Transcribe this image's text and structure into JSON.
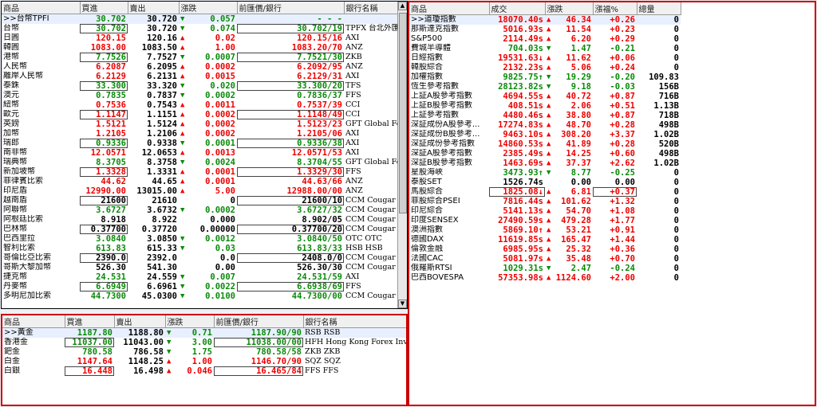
{
  "fx": {
    "headers": [
      "商品",
      "買進",
      "賣出",
      "漲跌",
      "前匯價/銀行",
      "銀行名稱"
    ],
    "rows": [
      {
        "name": ">>台幣TPFI",
        "bid": "30.702",
        "ask": "30.720",
        "chg": "0.057",
        "chg_dir": "down",
        "prev": "- - -",
        "prev_suffix": "",
        "bank": "",
        "color": "g"
      },
      {
        "name": "台幣",
        "bid": "30.702",
        "ask": "30.720",
        "chg": "0.074",
        "chg_dir": "down",
        "prev": "30.702",
        "prev_suffix": "/19",
        "bank": "TPFX 台北外匯經紀",
        "color": "g"
      },
      {
        "name": "日圓",
        "bid": "120.15",
        "ask": "120.16",
        "chg": "0.02",
        "chg_dir": "up",
        "prev": "120.15",
        "prev_suffix": "/16",
        "bank": "AXI",
        "color": "r"
      },
      {
        "name": "韓圓",
        "bid": "1083.00",
        "ask": "1083.50",
        "chg": "1.00",
        "chg_dir": "up",
        "prev": "1083.20",
        "prev_suffix": "/70",
        "bank": "ANZ",
        "color": "r"
      },
      {
        "name": "港幣",
        "bid": "7.7526",
        "ask": "7.7527",
        "chg": "0.0007",
        "chg_dir": "down",
        "prev": "7.7521",
        "prev_suffix": "/30",
        "bank": "ZKB",
        "color": "g"
      },
      {
        "name": "人民幣",
        "bid": "6.2087",
        "ask": "6.2095",
        "chg": "0.0002",
        "chg_dir": "up",
        "prev": "6.2092",
        "prev_suffix": "/95",
        "bank": "ANZ",
        "color": "r"
      },
      {
        "name": "離岸人民幣",
        "bid": "6.2129",
        "ask": "6.2131",
        "chg": "0.0015",
        "chg_dir": "up",
        "prev": "6.2129",
        "prev_suffix": "/31",
        "bank": "AXI",
        "color": "r"
      },
      {
        "name": "泰銖",
        "bid": "33.300",
        "ask": "33.320",
        "chg": "0.020",
        "chg_dir": "down",
        "prev": "33.300",
        "prev_suffix": "/20",
        "bank": "TFS",
        "color": "g"
      },
      {
        "name": "澳元",
        "bid": "0.7835",
        "ask": "0.7837",
        "chg": "0.0002",
        "chg_dir": "down",
        "prev": "0.7836",
        "prev_suffix": "/37",
        "bank": "FFS",
        "color": "g"
      },
      {
        "name": "紐幣",
        "bid": "0.7536",
        "ask": "0.7543",
        "chg": "0.0011",
        "chg_dir": "up",
        "prev": "0.7537",
        "prev_suffix": "/39",
        "bank": "CCI",
        "color": "r"
      },
      {
        "name": "歐元",
        "bid": "1.1147",
        "ask": "1.1151",
        "chg": "0.0002",
        "chg_dir": "up",
        "prev": "1.1148",
        "prev_suffix": "/49",
        "bank": "CCI",
        "color": "r"
      },
      {
        "name": "英鎊",
        "bid": "1.5121",
        "ask": "1.5124",
        "chg": "0.0002",
        "chg_dir": "up",
        "prev": "1.5123",
        "prev_suffix": "/23",
        "bank": "GFT Global Forex ...",
        "color": "r"
      },
      {
        "name": "加幣",
        "bid": "1.2105",
        "ask": "1.2106",
        "chg": "0.0002",
        "chg_dir": "up",
        "prev": "1.2105",
        "prev_suffix": "/06",
        "bank": "AXI",
        "color": "r"
      },
      {
        "name": "瑞郎",
        "bid": "0.9336",
        "ask": "0.9338",
        "chg": "0.0001",
        "chg_dir": "down",
        "prev": "0.9336",
        "prev_suffix": "/38",
        "bank": "AXI",
        "color": "g"
      },
      {
        "name": "南非幣",
        "bid": "12.0571",
        "ask": "12.0653",
        "chg": "0.0013",
        "chg_dir": "up",
        "prev": "12.0571",
        "prev_suffix": "/53",
        "bank": "AXI",
        "color": "r"
      },
      {
        "name": "瑞典幣",
        "bid": "8.3705",
        "ask": "8.3758",
        "chg": "0.0024",
        "chg_dir": "down",
        "prev": "8.3704",
        "prev_suffix": "/55",
        "bank": "GFT Global Forex ...",
        "color": "g"
      },
      {
        "name": "新加坡幣",
        "bid": "1.3328",
        "ask": "1.3331",
        "chg": "0.0001",
        "chg_dir": "up",
        "prev": "1.3329",
        "prev_suffix": "/30",
        "bank": "FFS",
        "color": "r"
      },
      {
        "name": "菲律賓比索",
        "bid": "44.62",
        "ask": "44.65",
        "chg": "0.0001",
        "chg_dir": "up",
        "prev": "44.63",
        "prev_suffix": "/66",
        "bank": "ANZ",
        "color": "r"
      },
      {
        "name": "印尼盾",
        "bid": "12990.00",
        "ask": "13015.00",
        "chg": "5.00",
        "chg_dir": "up",
        "prev": "12988.00",
        "prev_suffix": "/00",
        "bank": "ANZ",
        "color": "r"
      },
      {
        "name": "越南盾",
        "bid": "21600",
        "ask": "21610",
        "chg": "0",
        "chg_dir": "none",
        "prev": "21600",
        "prev_suffix": "/10",
        "bank": "CCM Cougar Capita...",
        "color": "k"
      },
      {
        "name": "阿聯幣",
        "bid": "3.6727",
        "ask": "3.6732",
        "chg": "0.0002",
        "chg_dir": "down",
        "prev": "3.6727",
        "prev_suffix": "/32",
        "bank": "CCM Cougar Capita...",
        "color": "g"
      },
      {
        "name": "阿根廷比索",
        "bid": "8.918",
        "ask": "8.922",
        "chg": "0.000",
        "chg_dir": "none",
        "prev": "8.902",
        "prev_suffix": "/05",
        "bank": "CCM Cougar Capita...",
        "color": "k"
      },
      {
        "name": "巴林幣",
        "bid": "0.37700",
        "ask": "0.37720",
        "chg": "0.00000",
        "chg_dir": "none",
        "prev": "0.37700",
        "prev_suffix": "/20",
        "bank": "CCM Cougar Capita...",
        "color": "k"
      },
      {
        "name": "巴西里拉",
        "bid": "3.0840",
        "ask": "3.0850",
        "chg": "0.0012",
        "chg_dir": "down",
        "prev": "3.0840",
        "prev_suffix": "/50",
        "bank": "OTC OTC",
        "color": "g"
      },
      {
        "name": "智利比索",
        "bid": "613.83",
        "ask": "615.33",
        "chg": "0.03",
        "chg_dir": "down",
        "prev": "613.83",
        "prev_suffix": "/33",
        "bank": "HSB HSB",
        "color": "g"
      },
      {
        "name": "哥倫比亞比索",
        "bid": "2390.0",
        "ask": "2392.0",
        "chg": "0.0",
        "chg_dir": "none",
        "prev": "2408.0",
        "prev_suffix": "/0",
        "bank": "CCM Cougar Capita...",
        "color": "k"
      },
      {
        "name": "哥斯大黎加幣",
        "bid": "526.30",
        "ask": "541.30",
        "chg": "0.00",
        "chg_dir": "none",
        "prev": "526.30",
        "prev_suffix": "/30",
        "bank": "CCM Cougar Capita...",
        "color": "k"
      },
      {
        "name": "捷克幣",
        "bid": "24.531",
        "ask": "24.559",
        "chg": "0.007",
        "chg_dir": "down",
        "prev": "24.531",
        "prev_suffix": "/59",
        "bank": "AXI",
        "color": "g"
      },
      {
        "name": "丹麥幣",
        "bid": "6.6949",
        "ask": "6.6961",
        "chg": "0.0022",
        "chg_dir": "down",
        "prev": "6.6938",
        "prev_suffix": "/69",
        "bank": "FFS",
        "color": "g"
      },
      {
        "name": "多明尼加比索",
        "bid": "44.7300",
        "ask": "45.0300",
        "chg": "0.0100",
        "chg_dir": "down",
        "prev": "44.7300",
        "prev_suffix": "/00",
        "bank": "CCM Cougar Capita...",
        "color": "g"
      }
    ]
  },
  "metals": {
    "headers": [
      "商品",
      "買進",
      "賣出",
      "漲跌",
      "前匯價/銀行",
      "銀行名稱"
    ],
    "rows": [
      {
        "name": ">>黃金",
        "bid": "1187.80",
        "ask": "1188.80",
        "chg": "0.71",
        "chg_dir": "down",
        "prev": "1187.90",
        "prev_suffix": "/90",
        "bank": "RSB RSB",
        "color": "g"
      },
      {
        "name": "香港金",
        "bid": "11037.00",
        "ask": "11043.00",
        "chg": "3.00",
        "chg_dir": "down",
        "prev": "11038.00",
        "prev_suffix": "/00",
        "bank": "HFH Hong Kong Forex Investm...",
        "color": "g"
      },
      {
        "name": "鈀金",
        "bid": "780.58",
        "ask": "786.58",
        "chg": "1.75",
        "chg_dir": "down",
        "prev": "780.58",
        "prev_suffix": "/58",
        "bank": "ZKB ZKB",
        "color": "g"
      },
      {
        "name": "白金",
        "bid": "1147.64",
        "ask": "1148.25",
        "chg": "1.00",
        "chg_dir": "up",
        "prev": "1146.70",
        "prev_suffix": "/90",
        "bank": "SQZ SQZ",
        "color": "r"
      },
      {
        "name": "白銀",
        "bid": "16.448",
        "ask": "16.498",
        "chg": "0.046",
        "chg_dir": "up",
        "prev": "16.465",
        "prev_suffix": "/84",
        "bank": "FFS FFS",
        "color": "r"
      }
    ]
  },
  "indices": {
    "headers": [
      "商品",
      "成交",
      "漲跌",
      "漲福%",
      "總量"
    ],
    "rows": [
      {
        "name": ">>道瓊指數",
        "last": "18070.40s",
        "chg": "46.34",
        "chg_dir": "up",
        "pct": "+0.26",
        "vol": "0",
        "color": "r"
      },
      {
        "name": "那斯達克指數",
        "last": "5016.93s",
        "chg": "11.54",
        "chg_dir": "up",
        "pct": "+0.23",
        "vol": "0",
        "color": "r"
      },
      {
        "name": "S&P500",
        "last": "2114.49s",
        "chg": "6.20",
        "chg_dir": "up",
        "pct": "+0.29",
        "vol": "0",
        "color": "r"
      },
      {
        "name": "費城半導體",
        "last": "704.03s",
        "chg": "1.47",
        "chg_dir": "down",
        "pct": "-0.21",
        "vol": "0",
        "color": "g"
      },
      {
        "name": "日經指數",
        "last": "19531.63↓",
        "chg": "11.62",
        "chg_dir": "up",
        "pct": "+0.06",
        "vol": "0",
        "color": "r"
      },
      {
        "name": "韓股綜合",
        "last": "2132.23s",
        "chg": "5.06",
        "chg_dir": "up",
        "pct": "+0.24",
        "vol": "0",
        "color": "r"
      },
      {
        "name": "加權指數",
        "last": "9825.75↑",
        "chg": "19.29",
        "chg_dir": "down",
        "pct": "-0.20",
        "vol": "109.83",
        "color": "g"
      },
      {
        "name": "恆生參考指數",
        "last": "28123.82s",
        "chg": "9.18",
        "chg_dir": "down",
        "pct": "-0.03",
        "vol": "156B",
        "color": "g"
      },
      {
        "name": "上証A股參考指數",
        "last": "4694.55s",
        "chg": "40.72",
        "chg_dir": "up",
        "pct": "+0.87",
        "vol": "716B",
        "color": "r"
      },
      {
        "name": "上証B股參考指數",
        "last": "408.51s",
        "chg": "2.06",
        "chg_dir": "up",
        "pct": "+0.51",
        "vol": "1.13B",
        "color": "r"
      },
      {
        "name": "上証參考指數",
        "last": "4480.46s",
        "chg": "38.80",
        "chg_dir": "up",
        "pct": "+0.87",
        "vol": "718B",
        "color": "r"
      },
      {
        "name": "深証成份A股參考...",
        "last": "17274.83s",
        "chg": "48.70",
        "chg_dir": "up",
        "pct": "+0.28",
        "vol": "498B",
        "color": "r"
      },
      {
        "name": "深証成份B股參考...",
        "last": "9463.10s",
        "chg": "308.20",
        "chg_dir": "up",
        "pct": "+3.37",
        "vol": "1.02B",
        "color": "r"
      },
      {
        "name": "深証成份參考指數",
        "last": "14860.53s",
        "chg": "41.89",
        "chg_dir": "up",
        "pct": "+0.28",
        "vol": "520B",
        "color": "r"
      },
      {
        "name": "深証A股參考指數",
        "last": "2385.49s",
        "chg": "14.25",
        "chg_dir": "up",
        "pct": "+0.60",
        "vol": "498B",
        "color": "r"
      },
      {
        "name": "深証B股參考指數",
        "last": "1463.69s",
        "chg": "37.37",
        "chg_dir": "up",
        "pct": "+2.62",
        "vol": "1.02B",
        "color": "r"
      },
      {
        "name": "星股海峽",
        "last": "3473.93↑",
        "chg": "8.77",
        "chg_dir": "down",
        "pct": "-0.25",
        "vol": "0",
        "color": "g"
      },
      {
        "name": "泰股SET",
        "last": "1526.74s",
        "chg": "0.00",
        "chg_dir": "none",
        "pct": "0.00",
        "vol": "0",
        "color": "k"
      },
      {
        "name": "馬股綜合",
        "last": "1825.08↓",
        "chg": "6.81",
        "chg_dir": "up",
        "pct": "+0.37",
        "vol": "0",
        "color": "r"
      },
      {
        "name": "菲股綜合PSEI",
        "last": "7816.44s",
        "chg": "101.62",
        "chg_dir": "up",
        "pct": "+1.32",
        "vol": "0",
        "color": "r"
      },
      {
        "name": "印尼綜合",
        "last": "5141.13s",
        "chg": "54.70",
        "chg_dir": "up",
        "pct": "+1.08",
        "vol": "0",
        "color": "r"
      },
      {
        "name": "印度SENSEX",
        "last": "27490.59s",
        "chg": "479.28",
        "chg_dir": "up",
        "pct": "+1.77",
        "vol": "0",
        "color": "r"
      },
      {
        "name": "澳洲指數",
        "last": "5869.10↑",
        "chg": "53.21",
        "chg_dir": "up",
        "pct": "+0.91",
        "vol": "0",
        "color": "r"
      },
      {
        "name": "德國DAX",
        "last": "11619.85s",
        "chg": "165.47",
        "chg_dir": "up",
        "pct": "+1.44",
        "vol": "0",
        "color": "r"
      },
      {
        "name": "倫敦金融",
        "last": "6985.95s",
        "chg": "25.32",
        "chg_dir": "up",
        "pct": "+0.36",
        "vol": "0",
        "color": "r"
      },
      {
        "name": "法國CAC",
        "last": "5081.97s",
        "chg": "35.48",
        "chg_dir": "up",
        "pct": "+0.70",
        "vol": "0",
        "color": "r"
      },
      {
        "name": "俄羅斯RTSI",
        "last": "1029.31s",
        "chg": "2.47",
        "chg_dir": "down",
        "pct": "-0.24",
        "vol": "0",
        "color": "g"
      },
      {
        "name": "巴西BOVESPA",
        "last": "57353.98s",
        "chg": "1124.60",
        "chg_dir": "up",
        "pct": "+2.00",
        "vol": "0",
        "color": "r"
      }
    ]
  },
  "icons": {
    "up": "▲",
    "down": "▼",
    "scroll_up": "▲",
    "scroll_down": "▼"
  }
}
